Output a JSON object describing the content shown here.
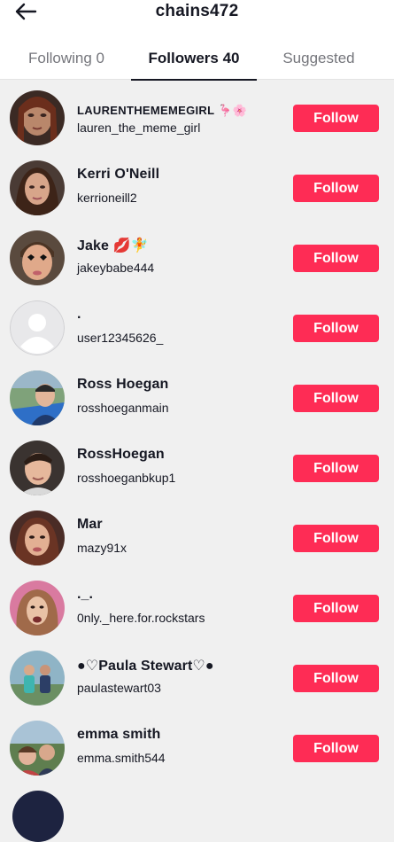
{
  "header": {
    "title": "chains472",
    "back_icon": "arrow-left-icon"
  },
  "tabs": [
    {
      "label": "Following 0",
      "selected": false
    },
    {
      "label": "Followers 40",
      "selected": true
    },
    {
      "label": "Suggested",
      "selected": false
    }
  ],
  "colors": {
    "accent": "#fe2c55",
    "background": "#f0f0f0"
  },
  "followers": [
    {
      "name": "LAURENTHEMEMEGIRL",
      "emoji": "🦩🌸",
      "handle": "lauren_the_meme_girl",
      "button": "Follow"
    },
    {
      "name": "Kerri O'Neill",
      "emoji": "",
      "handle": "kerrioneill2",
      "button": "Follow"
    },
    {
      "name": "Jake",
      "emoji": "💋🧚",
      "handle": "jakeybabe444",
      "button": "Follow"
    },
    {
      "name": ".",
      "emoji": "",
      "handle": "user12345626_",
      "button": "Follow"
    },
    {
      "name": "Ross Hoegan",
      "emoji": "",
      "handle": "rosshoeganmain",
      "button": "Follow"
    },
    {
      "name": "RossHoegan",
      "emoji": "",
      "handle": "rosshoeganbkup1",
      "button": "Follow"
    },
    {
      "name": "Mar",
      "emoji": "",
      "handle": "mazy91x",
      "button": "Follow"
    },
    {
      "name": "._.",
      "emoji": "",
      "handle": "0nly._here.for.rockstars",
      "button": "Follow"
    },
    {
      "name": "●♡Paula Stewart♡●",
      "emoji": "",
      "handle": "paulastewart03",
      "button": "Follow"
    },
    {
      "name": "emma smith",
      "emoji": "",
      "handle": "emma.smith544",
      "button": "Follow"
    }
  ]
}
